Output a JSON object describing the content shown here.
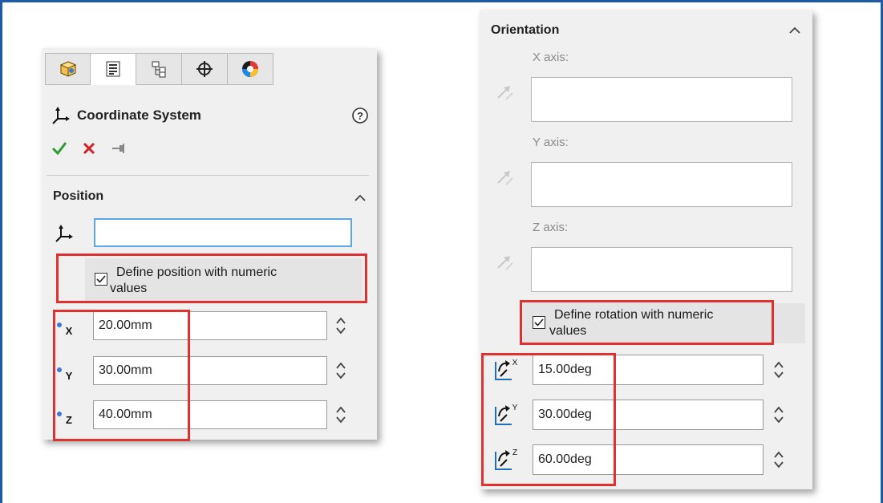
{
  "left_panel": {
    "tabs": [
      {
        "icon": "feature-manager-icon"
      },
      {
        "icon": "property-manager-icon"
      },
      {
        "icon": "configuration-manager-icon"
      },
      {
        "icon": "dimxpert-manager-icon"
      },
      {
        "icon": "display-manager-icon"
      }
    ],
    "title": "Coordinate System",
    "section_title": "Position",
    "checkbox_label_line1": "Define position with numeric",
    "checkbox_label_line2": "values",
    "checkbox_checked": true,
    "fields": [
      {
        "axis": "x",
        "value": "20.00mm"
      },
      {
        "axis": "y",
        "value": "30.00mm"
      },
      {
        "axis": "z",
        "value": "40.00mm"
      }
    ]
  },
  "right_panel": {
    "section_title": "Orientation",
    "axes": [
      {
        "label": "X axis:"
      },
      {
        "label": "Y axis:"
      },
      {
        "label": "Z axis:"
      }
    ],
    "checkbox_label_line1": "Define rotation with numeric",
    "checkbox_label_line2": "values",
    "checkbox_checked": true,
    "fields": [
      {
        "axis": "x",
        "value": "15.00deg"
      },
      {
        "axis": "y",
        "value": "30.00deg"
      },
      {
        "axis": "z",
        "value": "60.00deg"
      }
    ]
  },
  "colors": {
    "accent_blue": "#1f5aa6",
    "highlight_red": "#e03131",
    "ok_green": "#2e9b2e",
    "cancel_red": "#d32020",
    "selection_blue": "#5aa7e3"
  }
}
